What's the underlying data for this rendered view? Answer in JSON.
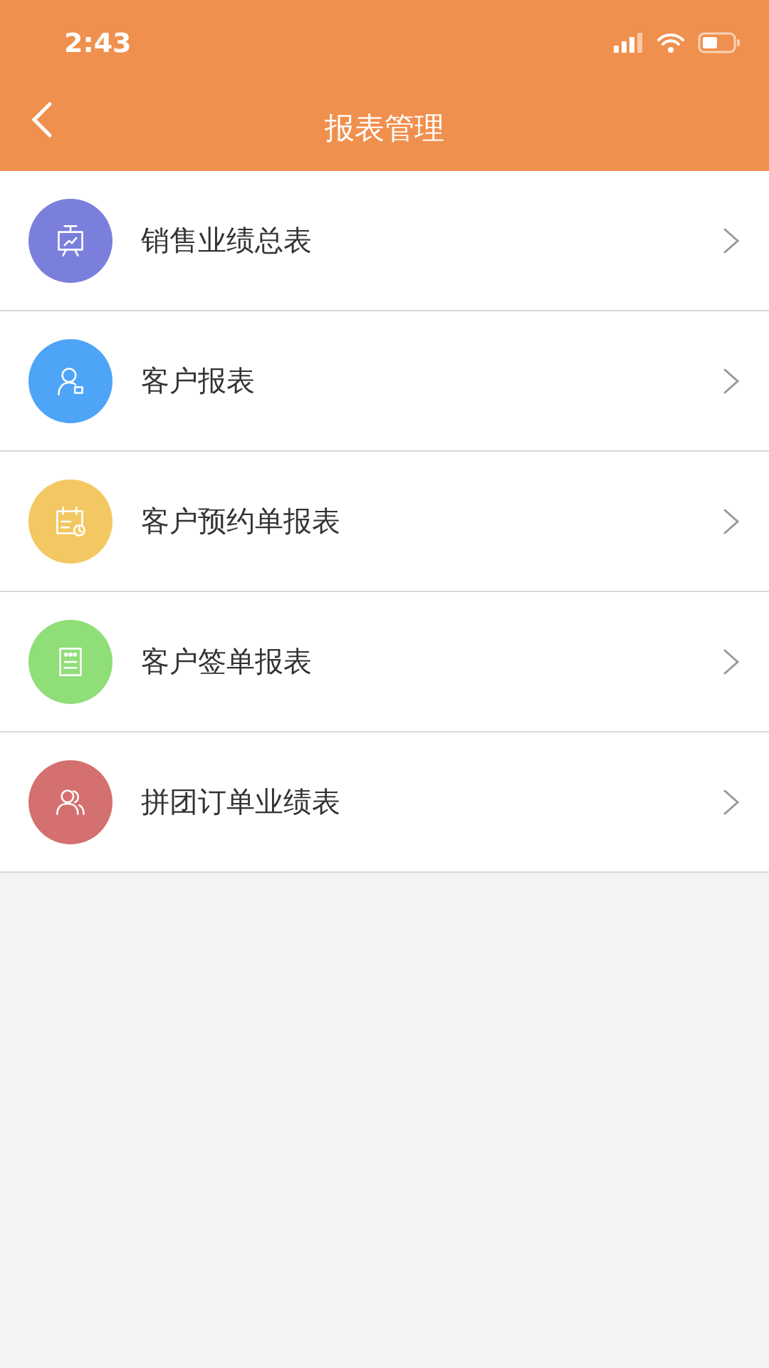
{
  "status_bar": {
    "time": "2:43"
  },
  "nav": {
    "title": "报表管理"
  },
  "items": [
    {
      "label": "销售业绩总表",
      "color": "#7b7fdc"
    },
    {
      "label": "客户报表",
      "color": "#4ea4f7"
    },
    {
      "label": "客户预约单报表",
      "color": "#f3c862"
    },
    {
      "label": "客户签单报表",
      "color": "#8fde78"
    },
    {
      "label": "拼团订单业绩表",
      "color": "#d4706f"
    }
  ]
}
